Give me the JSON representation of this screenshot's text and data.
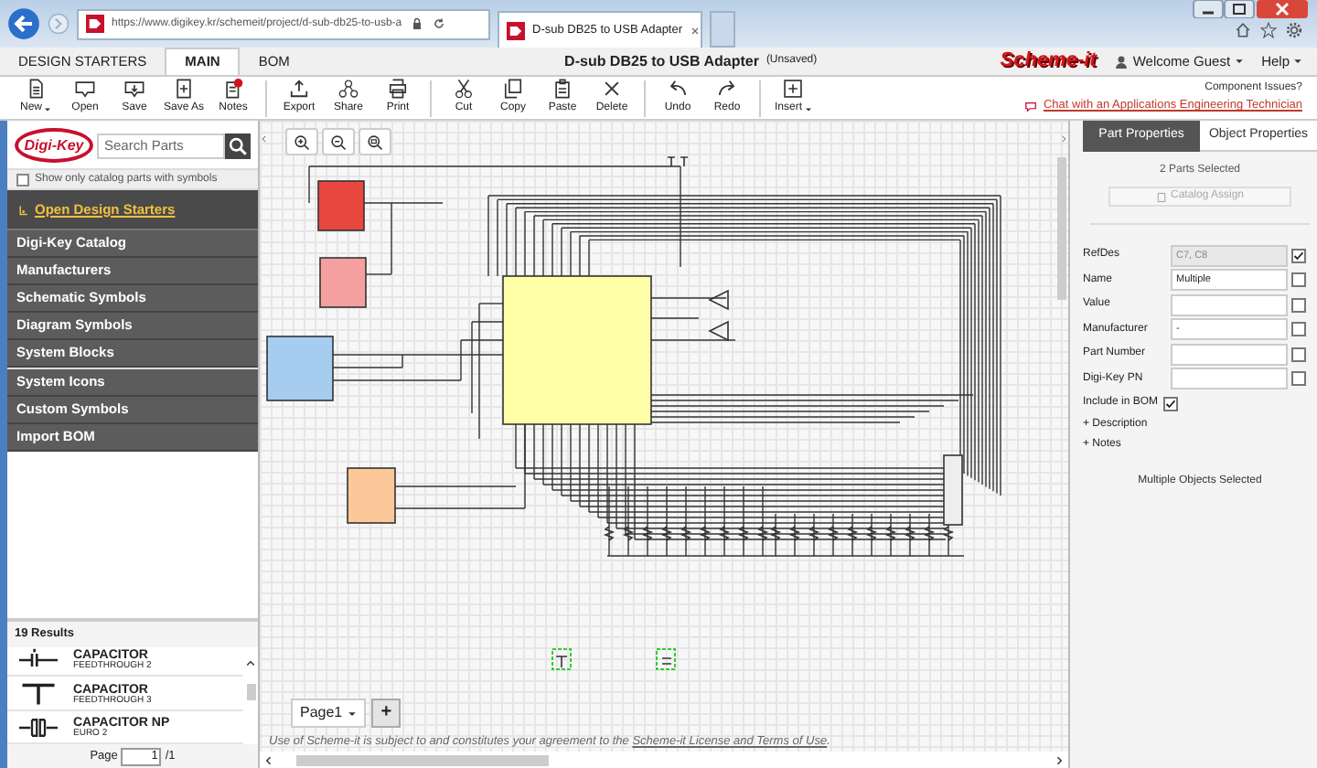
{
  "browser": {
    "address": "https://www.digikey.kr/schemeit/project/d-sub-db25-to-usb-a",
    "tab_title": "D-sub DB25 to USB Adapter"
  },
  "app_tabs": [
    {
      "label": "DESIGN STARTERS",
      "selected": false
    },
    {
      "label": "MAIN",
      "selected": true
    },
    {
      "label": "BOM",
      "selected": false
    }
  ],
  "document": {
    "title": "D-sub DB25 to USB Adapter",
    "status": "(Unsaved)"
  },
  "logo": "Scheme-it",
  "user_menu": "Welcome Guest",
  "help_menu": "Help",
  "toolbar": [
    [
      {
        "label": "New",
        "dropdown": true
      },
      {
        "label": "Open",
        "dropdown": false
      },
      {
        "label": "Save",
        "dropdown": false
      },
      {
        "label": "Save As",
        "dropdown": false
      },
      {
        "label": "Notes",
        "dropdown": false
      }
    ],
    [
      {
        "label": "Export",
        "dropdown": false
      },
      {
        "label": "Share",
        "dropdown": false
      },
      {
        "label": "Print",
        "dropdown": false
      }
    ],
    [
      {
        "label": "Cut",
        "dropdown": false
      },
      {
        "label": "Copy",
        "dropdown": false
      },
      {
        "label": "Paste",
        "dropdown": false
      },
      {
        "label": "Delete",
        "dropdown": false
      }
    ],
    [
      {
        "label": "Undo",
        "dropdown": false
      },
      {
        "label": "Redo",
        "dropdown": false
      }
    ],
    [
      {
        "label": "Insert",
        "dropdown": true
      }
    ]
  ],
  "support": {
    "prompt": "Component Issues?",
    "link": "Chat with an Applications Engineering Technician"
  },
  "search": {
    "logo": "Digi-Key",
    "placeholder": "Search Parts"
  },
  "catalog_filter": {
    "label": "Show only catalog parts with symbols",
    "checked": false
  },
  "design_starters": "Open Design Starters",
  "library_menu": [
    "Digi-Key Catalog",
    "Manufacturers",
    "Schematic Symbols",
    "Diagram Symbols",
    "System Blocks",
    "System Icons",
    "Custom Symbols",
    "Import BOM"
  ],
  "results": {
    "count": "19 Results",
    "items": [
      {
        "name": "CAPACITOR",
        "variant": "FEEDTHROUGH 2"
      },
      {
        "name": "CAPACITOR",
        "variant": "FEEDTHROUGH 3"
      },
      {
        "name": "CAPACITOR NP",
        "variant": "EURO 2"
      }
    ],
    "page_label": "Page",
    "page": "1",
    "page_total": "/1"
  },
  "canvas": {
    "pages": [
      {
        "label": "Page1",
        "selected": true
      }
    ],
    "add_page": "+",
    "footer": "Use of Scheme-it is subject to and constitutes your agreement to the ",
    "footer_link": "Scheme-it License and Terms of Use",
    "footer_end": "."
  },
  "properties": {
    "tabs": [
      {
        "label": "Part Properties",
        "selected": true
      },
      {
        "label": "Object Properties",
        "selected": false
      }
    ],
    "summary": "2 Parts Selected",
    "catalog_button": {
      "label": "Catalog Assign",
      "disabled": true
    },
    "fields": [
      {
        "label": "RefDes",
        "value": "C7, C8",
        "disabled": true,
        "checked": true
      },
      {
        "label": "Name",
        "value": "Multiple",
        "disabled": false,
        "checked": false
      },
      {
        "label": "Value",
        "disabled": false,
        "checked": false
      },
      {
        "label": "Manufacturer",
        "value": "-",
        "disabled": false,
        "checked": false
      },
      {
        "label": "Part Number",
        "disabled": false,
        "checked": false
      },
      {
        "label": "Digi-Key PN",
        "disabled": false,
        "checked": false
      }
    ],
    "include_in_bom": {
      "label": "Include in BOM",
      "checked": true
    },
    "sections": [
      "+ Description",
      "+ Notes"
    ],
    "status": "Multiple Objects Selected"
  }
}
